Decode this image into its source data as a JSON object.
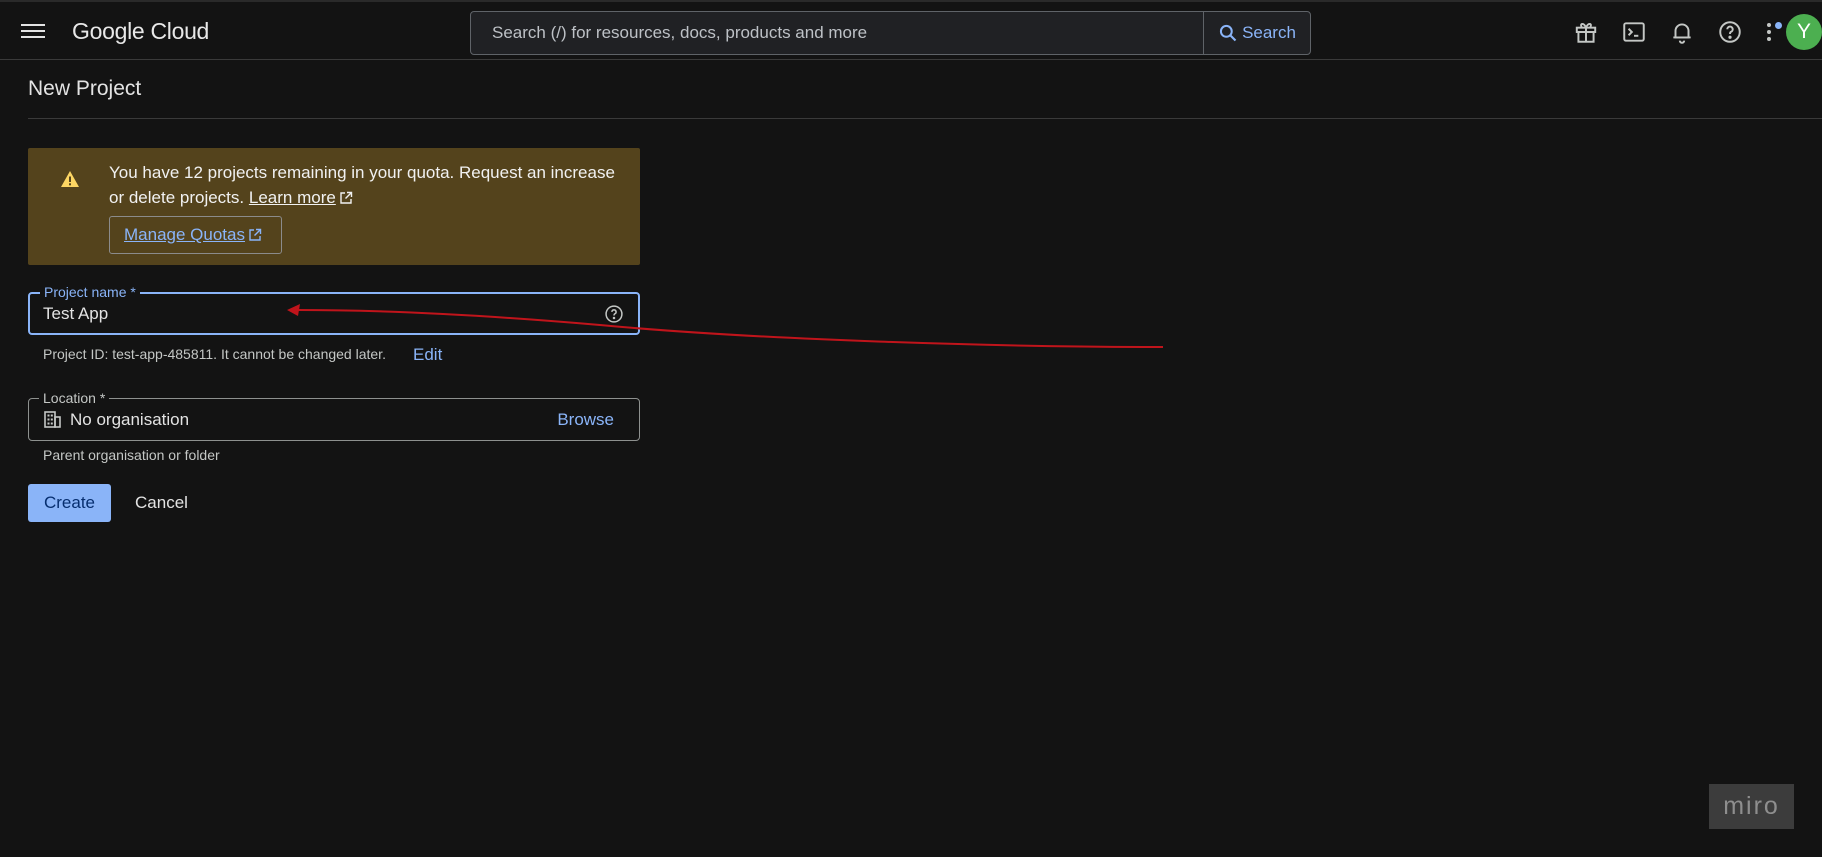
{
  "app": {
    "logo": "Google Cloud",
    "avatar_initial": "Y"
  },
  "search": {
    "placeholder": "Search (/) for resources, docs, products and more",
    "button_label": "Search"
  },
  "top_icons": [
    "gift-icon",
    "cloud-shell-icon",
    "bell-icon",
    "help-icon",
    "more-vert-icon"
  ],
  "page": {
    "title": "New Project"
  },
  "banner": {
    "text": "You have 12 projects remaining in your quota. Request an increase or delete projects.",
    "learn_more": "Learn more",
    "manage_quotas": "Manage Quotas"
  },
  "project_name": {
    "label": "Project name *",
    "value": "Test App",
    "id_text": "Project ID: test-app-485811. It cannot be changed later.",
    "edit_label": "Edit"
  },
  "location": {
    "label": "Location *",
    "value": "No organisation",
    "browse_label": "Browse",
    "helper": "Parent organisation or folder"
  },
  "actions": {
    "create": "Create",
    "cancel": "Cancel"
  },
  "watermark": "miro",
  "colors": {
    "background": "#131313",
    "accent": "#8ab4f8",
    "banner": "#54431c",
    "avatar": "#4caf50",
    "annotation_arrow": "#c0141b"
  }
}
